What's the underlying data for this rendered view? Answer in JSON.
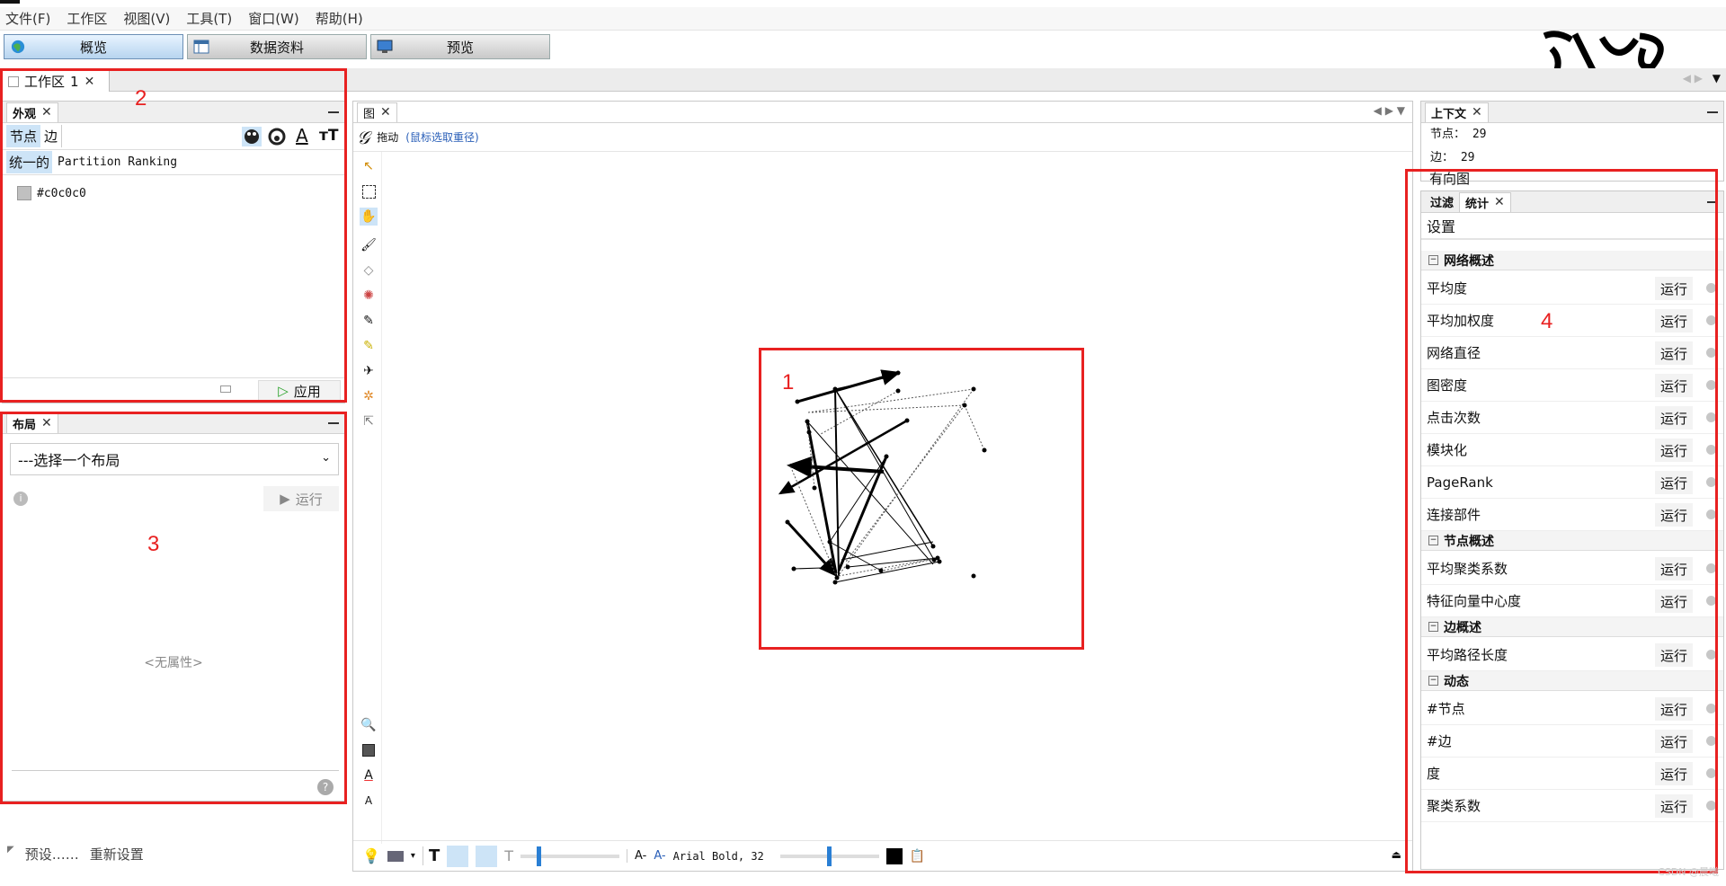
{
  "menu": [
    "文件(F)",
    "工作区",
    "视图(V)",
    "工具(T)",
    "窗口(W)",
    "帮助(H)"
  ],
  "modes": {
    "overview": "概览",
    "data": "数据资料",
    "preview": "预览"
  },
  "workspace_tab": {
    "label": "工作区",
    "number": "1",
    "close": "✕"
  },
  "appearance": {
    "tab": "外观",
    "close": "✕",
    "nodes": "节点",
    "edges": "边",
    "unique": "统一的",
    "partition_ranking": "Partition Ranking",
    "color_value": "#c0c0c0",
    "color_swatch": "#c0c0c0",
    "apply": "应用"
  },
  "layout": {
    "tab": "布局",
    "close": "✕",
    "select_placeholder": "---选择一个布局",
    "run": "运行",
    "no_props": "<无属性>",
    "presets": "预设……",
    "reset": "重新设置"
  },
  "graph": {
    "tab": "图",
    "close": "✕",
    "drag_label": "拖动",
    "drag_hint": "(鼠标选取重径)",
    "font_label": "Arial Bold, 32"
  },
  "context": {
    "tab": "上下文",
    "close": "✕",
    "nodes_label": "节点：",
    "nodes_value": "29",
    "edges_label": "边：",
    "edges_value": "29",
    "graph_type": "有向图"
  },
  "statistics": {
    "filter_tab": "过滤",
    "stats_tab": "统计",
    "close": "✕",
    "settings": "设置",
    "run_label": "运行",
    "sections": [
      {
        "title": "网络概述",
        "items": [
          "平均度",
          "平均加权度",
          "网络直径",
          "图密度",
          "点击次数",
          "模块化",
          "PageRank",
          "连接部件"
        ]
      },
      {
        "title": "节点概述",
        "items": [
          "平均聚类系数",
          "特征向量中心度"
        ]
      },
      {
        "title": "边概述",
        "items": [
          "平均路径长度"
        ]
      },
      {
        "title": "动态",
        "items": [
          "#节点",
          "#边",
          "度",
          "聚类系数"
        ]
      }
    ]
  },
  "annotations": {
    "n1": "1",
    "n2": "2",
    "n3": "3",
    "n4": "4"
  },
  "colors": {
    "annotation": "#e82121",
    "selected_tool": "#cde4f7"
  },
  "watermark": "CSDN @晨曦"
}
